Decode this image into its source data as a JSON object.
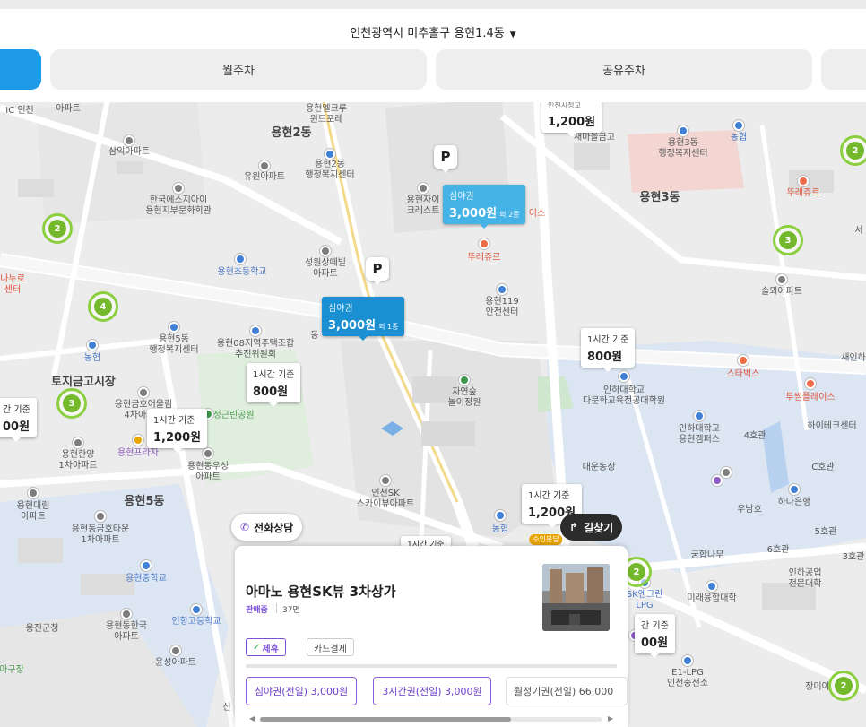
{
  "header": {
    "location": "인천광역시 미추홀구 용현1.4동",
    "tabs": [
      {
        "label": "",
        "active": true
      },
      {
        "label": "월주차",
        "active": false
      },
      {
        "label": "공유주차",
        "active": false
      },
      {
        "label": "",
        "active": false
      }
    ]
  },
  "colors": {
    "accent": "#1d9be8",
    "highlight_price": "#1a8fd1",
    "purple": "#7b4fd9",
    "cluster": "#74b92b"
  },
  "map": {
    "labels": {
      "ic_incheon": "IC 인천",
      "apt": "아파트",
      "yonghyeon_welcrew": "용현엘크루\n윈드포레",
      "yonghyeon2dong": "용현2동",
      "samik_apt": "삼익아파트",
      "yuwon_apt": "유원아파트",
      "yonghyeon2dong_center": "용현2동\n행정복지센터",
      "hanguk_esg": "한국에스지아이\n용현지부문화회관",
      "yonghyeon_crest": "용현자이\n크레스트",
      "semaul_geumgo": "새마을금고",
      "yonghyeon3dong_center": "용현3동\n행정복지센터",
      "nonghyup": "농협",
      "yonghyeon3dong": "용현3동",
      "ttu_jour_1": "뚜레쥬르",
      "ttu_jour_2": "뚜레쥬르",
      "ice_tail": "이스",
      "seongwon_apt": "성원상떼빌\n아파트",
      "yonghyeon_elem": "용현초등학교",
      "yonghyeon119": "용현119\n안전센터",
      "solmoe_apt": "솔뫼아파트",
      "nanuro": "나누로\n센터",
      "yonghyeon5dong_center": "용현5동\n행정복지센터",
      "yonghyeon08": "용현08지역주택조합\n추진위원회",
      "dong_short": "동",
      "nonghyup2": "농협",
      "tojigeum_market": "토지금고시장",
      "yonghyeon_geumho": "용현금호어울림\n4차아파트",
      "yongjeong_park": "용정근린공원",
      "jayeonsup": "자연숲\n놀이정원",
      "inha_multi": "인하대학교\n다문화교육전공대학원",
      "starbucks": "스타벅스",
      "twosome": "투썸플레이스",
      "saeinha": "새인하",
      "hitech_center": "하이테크센터",
      "yonghyeon_hanyang": "용현한양\n1차아파트",
      "yonghyeon_plaza": "용현프라자",
      "yonghyeon_dongwoo": "용현동우성\n아파트",
      "inha_campus": "인하대학교\n용현캠퍼스",
      "hall4": "4호관",
      "daewoon": "대운동장",
      "hallC": "C호관",
      "yonghyeon5dong": "용현5동",
      "incheon_sk": "인천SK\n스카이뷰아파트",
      "yonghyeon_daelim": "용현대림\n아파트",
      "yonghyeon_geumho_town": "용현동금호타운\n1차아파트",
      "hana_bank": "하나은행",
      "woorinam": "우남호",
      "hall5": "5호관",
      "hall6": "6호관",
      "hall3": "3호관",
      "gungnamu": "궁합나무",
      "inha_tech": "인하공업\n전문대학",
      "yonghyeon_middle": "용현중학교",
      "sk_energy": "SK엔크린\nLPG",
      "mirae_univ": "미래융합대학",
      "yongjin_gunsu": "용진군청",
      "yonghyeon_hanguk": "용현동한국\n아파트",
      "inhang_high": "인항고등학교",
      "yunseong_apt": "윤성아파트",
      "e1_lpg": "E1-LPG\n인천충전소",
      "jangmi": "장미아",
      "ga_gujang": "아구장",
      "sin": "신",
      "nong_small": "농협",
      "suin_station": "수인분당",
      "seo_label": "서"
    },
    "clusters": [
      "2",
      "3",
      "2",
      "4",
      "3",
      "2",
      "2"
    ],
    "parking_marks": [
      "P",
      "P"
    ],
    "price_markers": [
      {
        "label": "심야권",
        "price": "3,000원",
        "extra": "외 2종"
      },
      {
        "label": "심야권",
        "price": "3,000원",
        "extra": "외 1종"
      },
      {
        "label": "1시간 기준",
        "price": "1,200원"
      },
      {
        "label": "1시간 기준",
        "price": "800원"
      },
      {
        "label": "1시간 기준",
        "price": "800원"
      },
      {
        "label": "1시간 기준",
        "price": "1,200원"
      },
      {
        "label": "1시간 기준",
        "price": "1,200원"
      },
      {
        "label": "간 기준",
        "price": "00원"
      },
      {
        "label": "간 기준",
        "price": "00원"
      },
      {
        "label": "1시간 기준",
        "price": ""
      },
      {
        "label": "인천시청교",
        "price": "1,200원"
      }
    ]
  },
  "buttons": {
    "phone_icon": "phone-icon",
    "phone_label": "전화상담",
    "route_icon": "turn-right-icon",
    "route_label": "길찾기"
  },
  "card": {
    "title": "아마노 용현SK뷰 3차상가",
    "status": "판매중",
    "spaces": "37면",
    "tags": {
      "partner": "제휴",
      "card_pay": "카드결제"
    },
    "tickets": [
      {
        "label": "심야권(전일) 3,000원",
        "selected": true
      },
      {
        "label": "3시간권(전일) 3,000원",
        "selected": true
      },
      {
        "label": "월정기권(전일) 66,000",
        "selected": false
      }
    ]
  }
}
